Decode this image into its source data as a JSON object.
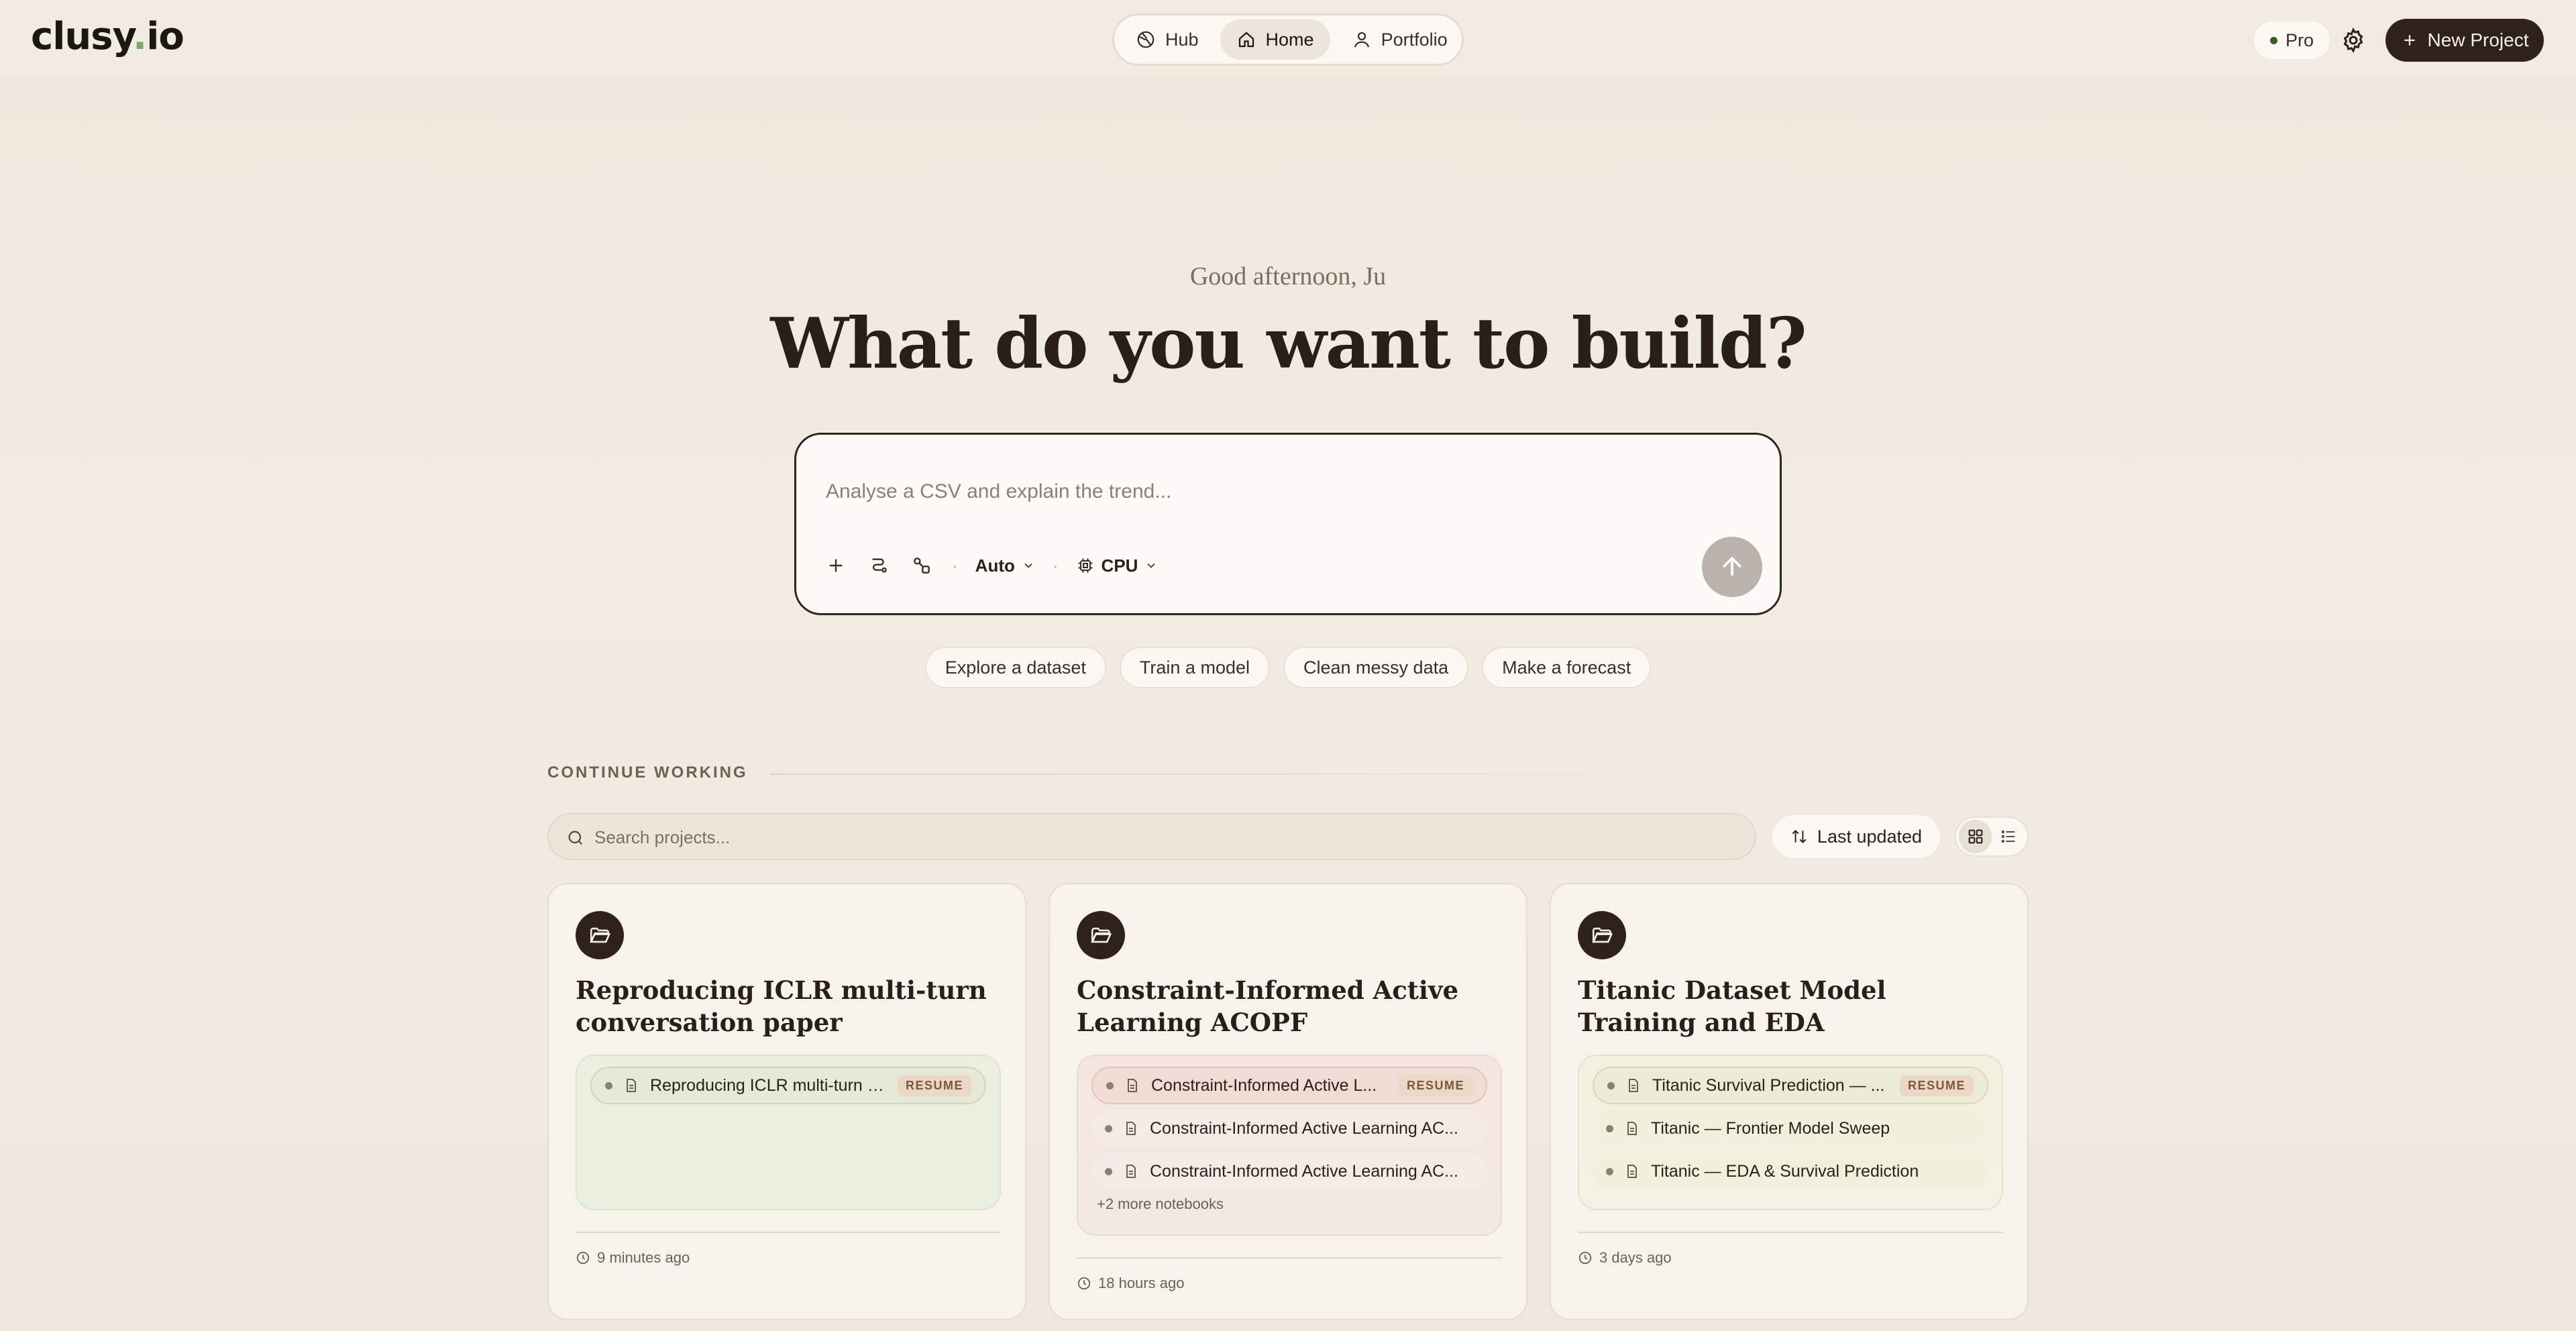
{
  "brand": {
    "logo": "clusy.io",
    "logo_main": "clusy",
    "logo_dot": ".",
    "logo_tld": "io"
  },
  "nav": {
    "items": [
      {
        "label": "Hub",
        "icon": "globe-icon"
      },
      {
        "label": "Home",
        "icon": "home-icon",
        "active": true
      },
      {
        "label": "Portfolio",
        "icon": "user-icon"
      }
    ]
  },
  "header": {
    "plan_label": "Pro",
    "new_project_label": "New Project"
  },
  "hero": {
    "greeting": "Good afternoon, Ju",
    "headline": "What do you want to build?"
  },
  "prompt": {
    "placeholder": "Analyse a CSV and explain the trend...",
    "mode_label": "Auto",
    "compute_label": "CPU"
  },
  "suggestions": [
    "Explore a dataset",
    "Train a model",
    "Clean messy data",
    "Make a forecast"
  ],
  "projects_section": {
    "title": "CONTINUE WORKING",
    "search_placeholder": "Search projects...",
    "sort_label": "Last updated"
  },
  "cards": [
    {
      "title": "Reproducing ICLR multi-turn conversation paper",
      "theme": "green",
      "notebooks": [
        {
          "name": "Reproducing ICLR multi-turn c...",
          "resume": true
        }
      ],
      "more": "",
      "time": "9 minutes ago"
    },
    {
      "title": "Constraint-Informed Active Learning ACOPF",
      "theme": "pink",
      "notebooks": [
        {
          "name": "Constraint-Informed Active L...",
          "resume": true
        },
        {
          "name": "Constraint-Informed Active Learning AC...",
          "resume": false
        },
        {
          "name": "Constraint-Informed Active Learning AC...",
          "resume": false
        }
      ],
      "more": "+2 more notebooks",
      "time": "18 hours ago"
    },
    {
      "title": "Titanic Dataset Model Training and EDA",
      "theme": "cream",
      "notebooks": [
        {
          "name": "Titanic Survival Prediction — ...",
          "resume": true
        },
        {
          "name": "Titanic — Frontier Model Sweep",
          "resume": false
        },
        {
          "name": "Titanic — EDA & Survival Prediction",
          "resume": false
        }
      ],
      "more": "",
      "time": "3 days ago"
    }
  ],
  "resume_badge": "RESUME",
  "colors": {
    "accent_dark": "#2e221b",
    "background": "#efe8dd",
    "status_green": "#3a5a2a"
  }
}
